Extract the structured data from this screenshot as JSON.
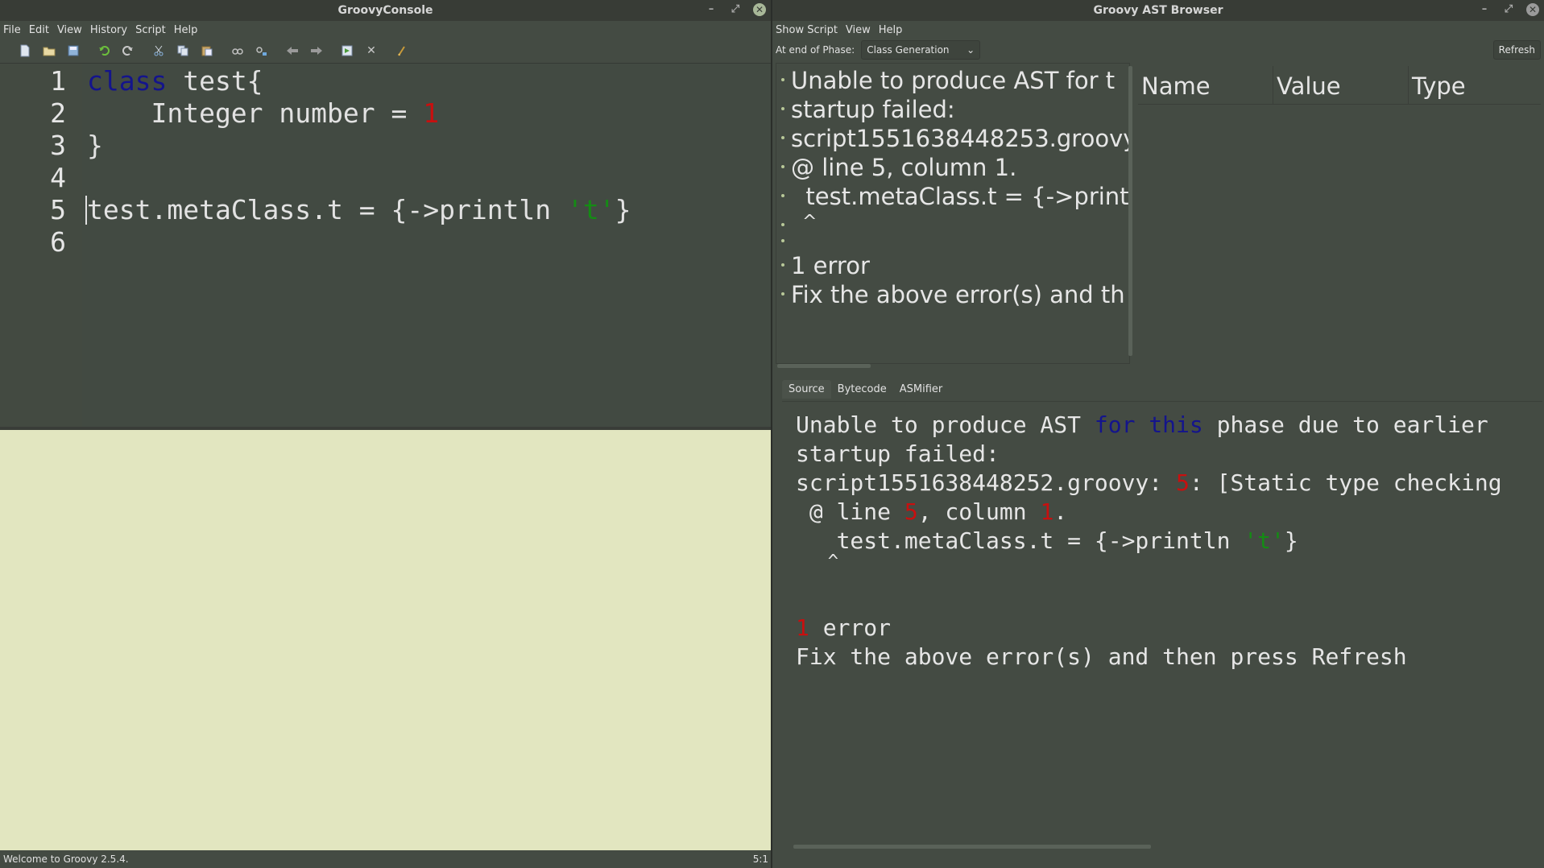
{
  "console": {
    "title": "GroovyConsole",
    "menu": [
      "File",
      "Edit",
      "View",
      "History",
      "Script",
      "Help"
    ],
    "line_numbers": [
      "1",
      "2",
      "3",
      "4",
      "5",
      "6"
    ],
    "code": {
      "l1_kw": "class",
      "l1_rest": " test{",
      "l2_a": "    Integer number = ",
      "l2_num": "1",
      "l3": "}",
      "l5_a": "test.metaClass.t = {->println ",
      "l5_str": "'t'",
      "l5_b": "}"
    },
    "status_text": "Welcome to Groovy 2.5.4.",
    "cursor_position": "5:1"
  },
  "ast": {
    "title": "Groovy AST Browser",
    "menu": [
      "Show Script",
      "View",
      "Help"
    ],
    "phase_label": "At end of Phase:",
    "phase_value": "Class Generation",
    "refresh_label": "Refresh",
    "tree_items": [
      "Unable to produce AST for t",
      "startup failed:",
      "script1551638448253.groovy",
      "@ line 5, column 1.",
      "  test.metaClass.t = {->print",
      "  ^",
      "",
      "1 error",
      "Fix the above error(s) and th"
    ],
    "columns": [
      "Name",
      "Value",
      "Type"
    ],
    "tabs": [
      "Source",
      "Bytecode",
      "ASMifier"
    ],
    "source": {
      "l1_a": "Unable to produce AST ",
      "l1_kw1": "for",
      "l1_sp": " ",
      "l1_kw2": "this",
      "l1_b": " phase due to earlier",
      "l2": "startup failed:",
      "l3_a": "script1551638448252.groovy: ",
      "l3_num": "5",
      "l3_b": ": [Static type checking",
      "l4_a": " @ line ",
      "l4_num1": "5",
      "l4_b": ", column ",
      "l4_num2": "1",
      "l4_c": ".",
      "l5_a": "   test.metaClass.t = {->println ",
      "l5_str": "'t'",
      "l5_b": "}",
      "l6": "   ^",
      "l8_num": "1",
      "l8_b": " error",
      "l9": "Fix the above error(s) and then press Refresh"
    }
  },
  "colors": {
    "window_bg": "#444b43",
    "output_bg": "#e2e6c0",
    "keyword": "#14148c",
    "number": "#c80f0f",
    "string": "#148c14"
  }
}
